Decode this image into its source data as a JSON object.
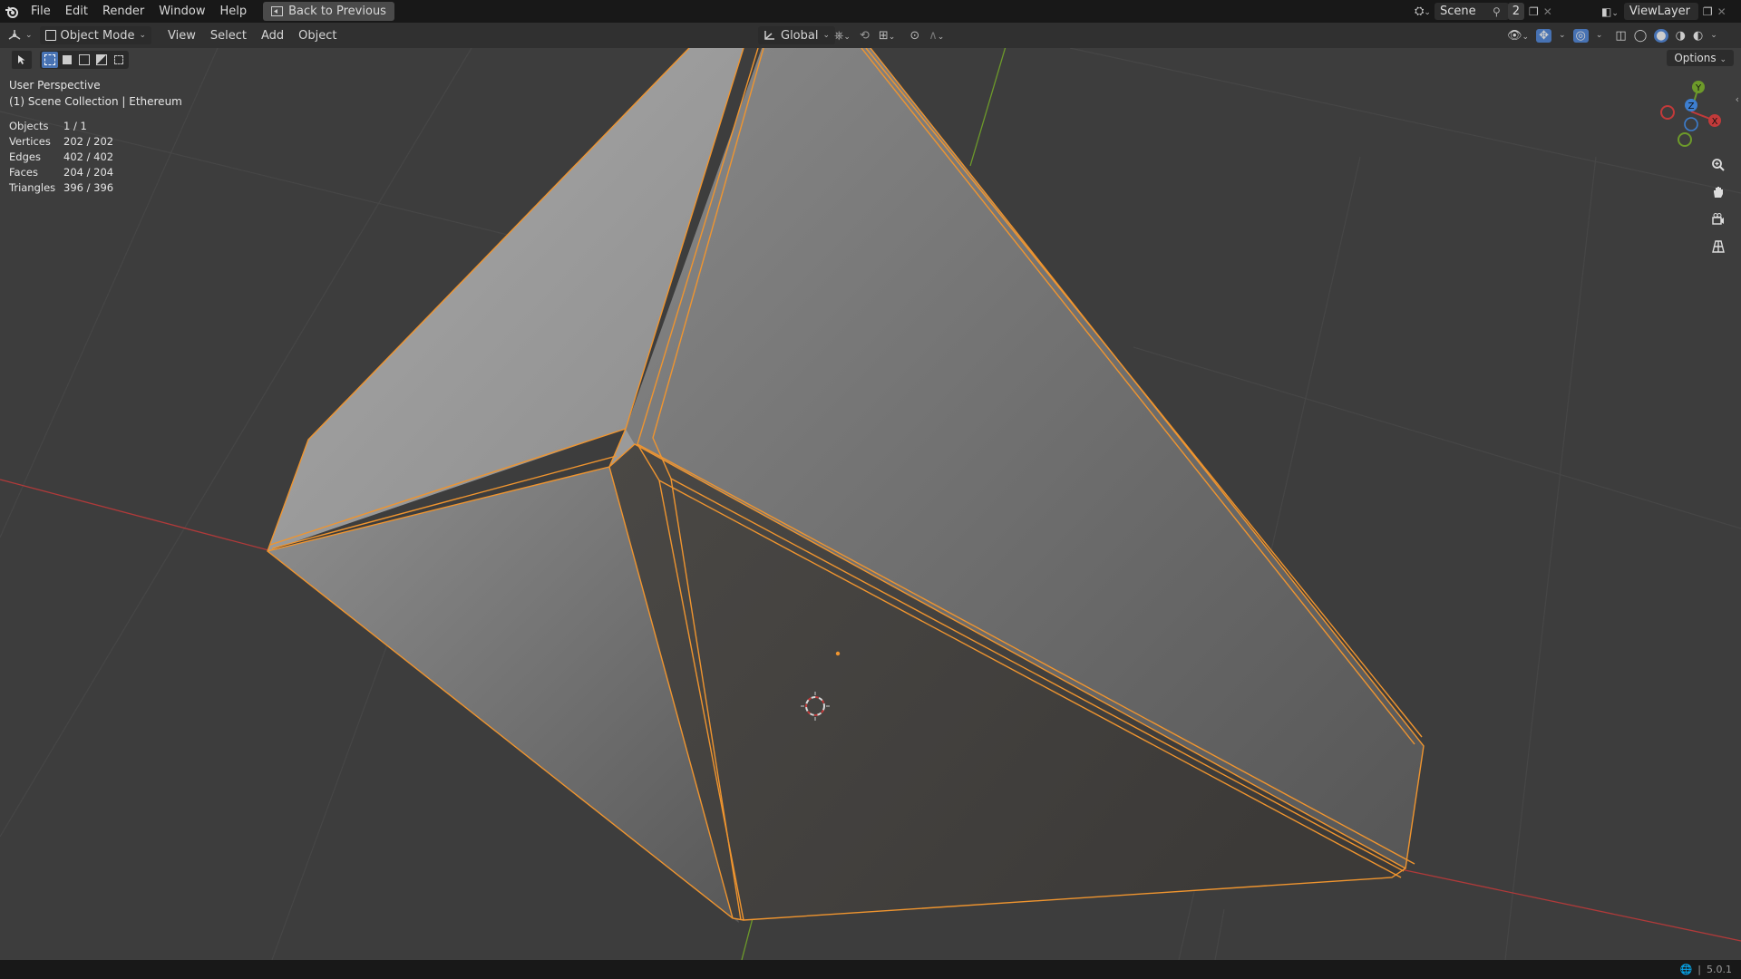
{
  "topbar": {
    "menus": [
      "File",
      "Edit",
      "Render",
      "Window",
      "Help"
    ],
    "back_button": "Back to Previous",
    "scene": "Scene",
    "users_count": "2",
    "view_layer": "ViewLayer"
  },
  "header": {
    "mode": "Object Mode",
    "menus": [
      "View",
      "Select",
      "Add",
      "Object"
    ],
    "transform_orientation": "Global",
    "options": "Options"
  },
  "viewport": {
    "view_name": "User Perspective",
    "collection": "(1) Scene Collection | Ethereum",
    "stats": [
      {
        "label": "Objects",
        "value": "1 / 1"
      },
      {
        "label": "Vertices",
        "value": "202 / 202"
      },
      {
        "label": "Edges",
        "value": "402 / 402"
      },
      {
        "label": "Faces",
        "value": "204 / 204"
      },
      {
        "label": "Triangles",
        "value": "396 / 396"
      }
    ],
    "gizmo": {
      "x": "X",
      "y": "Y",
      "z": "Z"
    }
  },
  "colors": {
    "selection": "#f0952f",
    "x_axis": "#b03a3a",
    "y_axis": "#6d9a2a",
    "z_axis": "#3d7ecf",
    "accent": "#4772b3"
  },
  "statusbar": {
    "version": "5.0.1"
  }
}
